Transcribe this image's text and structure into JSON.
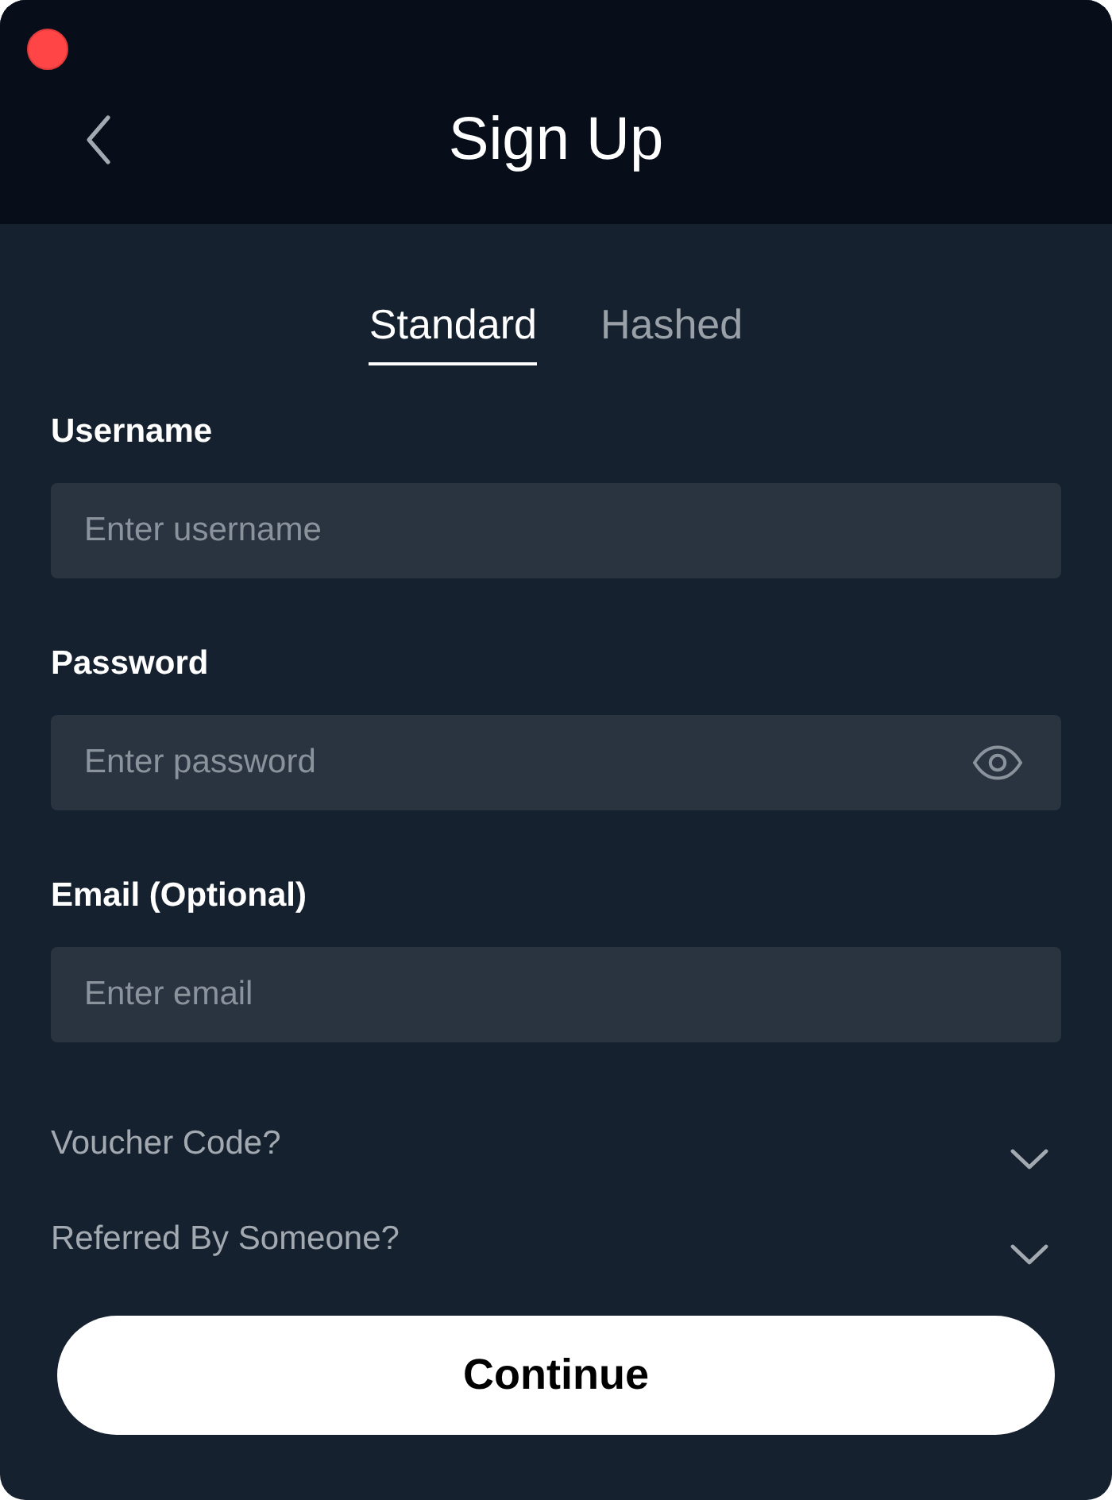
{
  "window": {
    "title": "Sign Up"
  },
  "tabs": [
    {
      "label": "Standard",
      "selected": true
    },
    {
      "label": "Hashed",
      "selected": false
    }
  ],
  "fields": [
    {
      "kind": "text",
      "label": "Username",
      "placeholder": "Enter username"
    },
    {
      "kind": "password",
      "label": "Password",
      "placeholder": "Enter password"
    },
    {
      "kind": "email",
      "label": "Email (Optional)",
      "placeholder": "Enter email"
    }
  ],
  "sections": [
    {
      "label": "Voucher Code?",
      "expanded": false
    },
    {
      "label": "Referred By Someone?",
      "expanded": false
    }
  ],
  "submit": {
    "label": "Continue"
  }
}
